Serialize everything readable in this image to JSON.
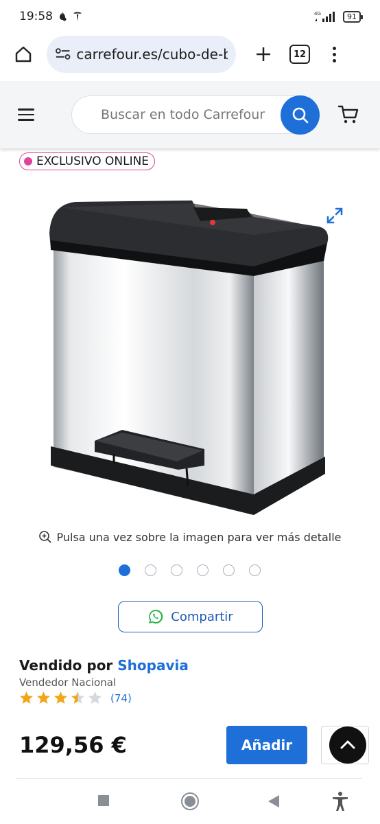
{
  "status_bar": {
    "time": "19:58",
    "network": "4G",
    "battery": "91"
  },
  "browser": {
    "url": "carrefour.es/cubo-de-b",
    "tab_count": "12"
  },
  "header": {
    "search_placeholder": "Buscar en todo Carrefour"
  },
  "product": {
    "badge": "EXCLUSIVO ONLINE",
    "zoom_hint": "Pulsa una vez sobre la imagen para ver más detalle",
    "carousel": {
      "total": 6,
      "active_index": 0
    },
    "share_label": "Compartir",
    "seller_prefix": "Vendido por",
    "seller_name": "Shopavia",
    "seller_type": "Vendedor Nacional",
    "rating": 3.5,
    "rating_max": 5,
    "review_count": "(74)",
    "price": "129,56 €",
    "add_label": "Añadir"
  },
  "colors": {
    "brand_blue": "#1e70d8",
    "badge_pink": "#e0449a",
    "star_gold": "#f2a51a",
    "header_bg": "#f4f5f7"
  },
  "icons": [
    "home-icon",
    "site-settings-icon",
    "plus-icon",
    "tabs-icon",
    "more-vert-icon",
    "hamburger-icon",
    "search-icon",
    "cart-icon",
    "expand-icon",
    "zoom-in-icon",
    "whatsapp-icon",
    "star-icon",
    "arrow-up-icon",
    "nav-recents-icon",
    "nav-home-icon",
    "nav-back-icon",
    "accessibility-icon"
  ]
}
